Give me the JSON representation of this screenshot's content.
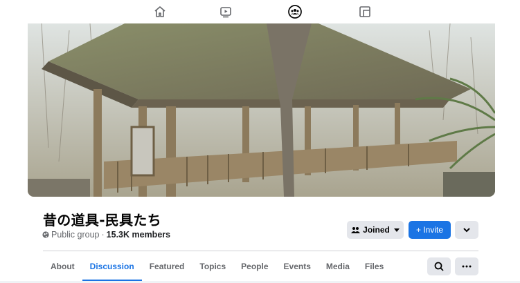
{
  "topnav": {
    "icons": [
      "home-icon",
      "watch-icon",
      "groups-icon",
      "gaming-icon"
    ]
  },
  "cover": {
    "description_icon": "covered-wooden-bridge-photo"
  },
  "group": {
    "name": "昔の道具-民具たち",
    "privacy": "Public group",
    "separator": "·",
    "members": "15.3K members"
  },
  "actions": {
    "joined_label": "Joined",
    "invite_label": "+ Invite"
  },
  "tabs": [
    {
      "label": "About",
      "active": false
    },
    {
      "label": "Discussion",
      "active": true
    },
    {
      "label": "Featured",
      "active": false
    },
    {
      "label": "Topics",
      "active": false
    },
    {
      "label": "People",
      "active": false
    },
    {
      "label": "Events",
      "active": false
    },
    {
      "label": "Media",
      "active": false
    },
    {
      "label": "Files",
      "active": false
    }
  ],
  "colors": {
    "accent": "#1b74e4",
    "button_gray": "#e4e6eb",
    "muted_text": "#65676b"
  }
}
